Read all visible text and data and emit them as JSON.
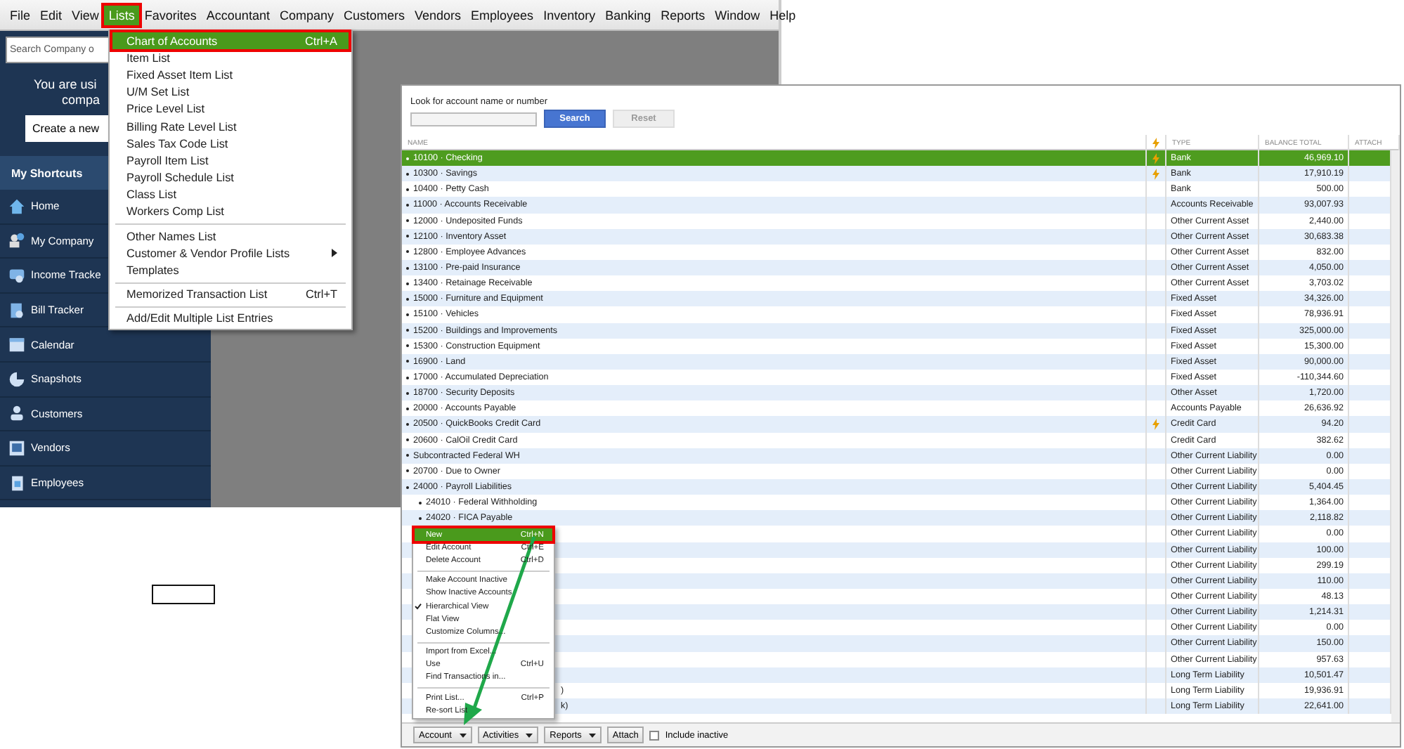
{
  "menu_bar": [
    {
      "label": "File",
      "selected": false
    },
    {
      "label": "Edit",
      "selected": false
    },
    {
      "label": "View",
      "selected": false
    },
    {
      "label": "Lists",
      "selected": true
    },
    {
      "label": "Favorites",
      "selected": false
    },
    {
      "label": "Accountant",
      "selected": false
    },
    {
      "label": "Company",
      "selected": false
    },
    {
      "label": "Customers",
      "selected": false
    },
    {
      "label": "Vendors",
      "selected": false
    },
    {
      "label": "Employees",
      "selected": false
    },
    {
      "label": "Inventory",
      "selected": false
    },
    {
      "label": "Banking",
      "selected": false
    },
    {
      "label": "Reports",
      "selected": false
    },
    {
      "label": "Window",
      "selected": false
    },
    {
      "label": "Help",
      "selected": false
    }
  ],
  "lists_menu": [
    {
      "kind": "item",
      "label": "Chart of Accounts",
      "shortcut": "Ctrl+A",
      "selected": true
    },
    {
      "kind": "item",
      "label": "Item List",
      "selected": false
    },
    {
      "kind": "item",
      "label": "Fixed Asset Item List",
      "selected": false
    },
    {
      "kind": "item",
      "label": "U/M Set List",
      "selected": false
    },
    {
      "kind": "item",
      "label": "Price Level List",
      "selected": false
    },
    {
      "kind": "item",
      "label": "Billing Rate Level List",
      "selected": false
    },
    {
      "kind": "item",
      "label": "Sales Tax Code List",
      "selected": false
    },
    {
      "kind": "item",
      "label": "Payroll Item List",
      "selected": false
    },
    {
      "kind": "item",
      "label": "Payroll Schedule List",
      "selected": false
    },
    {
      "kind": "item",
      "label": "Class List",
      "selected": false
    },
    {
      "kind": "item",
      "label": "Workers Comp List",
      "selected": false
    },
    {
      "kind": "separator"
    },
    {
      "kind": "item",
      "label": "Other Names List",
      "selected": false
    },
    {
      "kind": "submenu",
      "label": "Customer & Vendor Profile Lists",
      "selected": false
    },
    {
      "kind": "item",
      "label": "Templates",
      "selected": false
    },
    {
      "kind": "separator"
    },
    {
      "kind": "item",
      "label": "Memorized Transaction List",
      "shortcut": "Ctrl+T",
      "selected": false
    },
    {
      "kind": "separator"
    },
    {
      "kind": "item",
      "label": "Add/Edit Multiple List Entries",
      "selected": false
    }
  ],
  "sidebar": {
    "search_placeholder": "Search Company o",
    "banner": [
      "You are usi",
      "compa"
    ],
    "create_button": "Create a new",
    "shortcuts_title": "My Shortcuts",
    "items": [
      {
        "label": "Home"
      },
      {
        "label": "My Company"
      },
      {
        "label": "Income Tracke"
      },
      {
        "label": "Bill Tracker"
      },
      {
        "label": "Calendar"
      },
      {
        "label": "Snapshots"
      },
      {
        "label": "Customers"
      },
      {
        "label": "Vendors"
      },
      {
        "label": "Employees"
      }
    ]
  },
  "chart_of_accounts": {
    "search_label": "Look for account name or number",
    "search_button": "Search",
    "reset_button": "Reset",
    "columns": [
      "NAME",
      "TYPE",
      "BALANCE TOTAL",
      "ATTACH"
    ],
    "rows": [
      {
        "name": "10100 · Checking",
        "online": true,
        "type": "Bank",
        "balance": "46,969.10",
        "selected": true
      },
      {
        "name": "10300 · Savings",
        "online": true,
        "type": "Bank",
        "balance": "17,910.19",
        "selected": false
      },
      {
        "name": "10400 · Petty Cash",
        "online": false,
        "type": "Bank",
        "balance": "500.00",
        "selected": false
      },
      {
        "name": "11000 · Accounts Receivable",
        "online": false,
        "type": "Accounts Receivable",
        "balance": "93,007.93",
        "selected": false
      },
      {
        "name": "12000 · Undeposited Funds",
        "online": false,
        "type": "Other Current Asset",
        "balance": "2,440.00",
        "selected": false
      },
      {
        "name": "12100 · Inventory Asset",
        "online": false,
        "type": "Other Current Asset",
        "balance": "30,683.38",
        "selected": false
      },
      {
        "name": "12800 · Employee Advances",
        "online": false,
        "type": "Other Current Asset",
        "balance": "832.00",
        "selected": false
      },
      {
        "name": "13100 · Pre-paid Insurance",
        "online": false,
        "type": "Other Current Asset",
        "balance": "4,050.00",
        "selected": false
      },
      {
        "name": "13400 · Retainage Receivable",
        "online": false,
        "type": "Other Current Asset",
        "balance": "3,703.02",
        "selected": false
      },
      {
        "name": "15000 · Furniture and Equipment",
        "online": false,
        "type": "Fixed Asset",
        "balance": "34,326.00",
        "selected": false
      },
      {
        "name": "15100 · Vehicles",
        "online": false,
        "type": "Fixed Asset",
        "balance": "78,936.91",
        "selected": false
      },
      {
        "name": "15200 · Buildings and Improvements",
        "online": false,
        "type": "Fixed Asset",
        "balance": "325,000.00",
        "selected": false
      },
      {
        "name": "15300 · Construction Equipment",
        "online": false,
        "type": "Fixed Asset",
        "balance": "15,300.00",
        "selected": false
      },
      {
        "name": "16900 · Land",
        "online": false,
        "type": "Fixed Asset",
        "balance": "90,000.00",
        "selected": false
      },
      {
        "name": "17000 · Accumulated Depreciation",
        "online": false,
        "type": "Fixed Asset",
        "balance": "-110,344.60",
        "selected": false
      },
      {
        "name": "18700 · Security Deposits",
        "online": false,
        "type": "Other Asset",
        "balance": "1,720.00",
        "selected": false
      },
      {
        "name": "20000 · Accounts Payable",
        "online": false,
        "type": "Accounts Payable",
        "balance": "26,636.92",
        "selected": false
      },
      {
        "name": "20500 · QuickBooks Credit Card",
        "online": true,
        "type": "Credit Card",
        "balance": "94.20",
        "selected": false
      },
      {
        "name": "20600 · CalOil Credit Card",
        "online": false,
        "type": "Credit Card",
        "balance": "382.62",
        "selected": false
      },
      {
        "name": "Subcontracted Federal WH",
        "online": false,
        "type": "Other Current Liability",
        "balance": "0.00",
        "selected": false
      },
      {
        "name": "20700 · Due to Owner",
        "online": false,
        "type": "Other Current Liability",
        "balance": "0.00",
        "selected": false
      },
      {
        "name": "24000 · Payroll Liabilities",
        "online": false,
        "type": "Other Current Liability",
        "balance": "5,404.45",
        "selected": false,
        "children": [
          {
            "name": "24010 · Federal Withholding",
            "online": false,
            "type": "Other Current Liability",
            "balance": "1,364.00",
            "selected": false
          },
          {
            "name": "24020 · FICA Payable",
            "online": false,
            "type": "Other Current Liability",
            "balance": "2,118.82",
            "selected": false
          }
        ]
      },
      {
        "online": false,
        "type": "Other Current Liability",
        "balance": "0.00",
        "selected": false
      },
      {
        "online": false,
        "type": "Other Current Liability",
        "balance": "100.00",
        "selected": false
      },
      {
        "online": false,
        "type": "Other Current Liability",
        "balance": "299.19",
        "selected": false
      },
      {
        "online": false,
        "type": "Other Current Liability",
        "balance": "110.00",
        "selected": false
      },
      {
        "online": false,
        "type": "Other Current Liability",
        "balance": "48.13",
        "selected": false
      },
      {
        "online": false,
        "type": "Other Current Liability",
        "balance": "1,214.31",
        "selected": false
      },
      {
        "online": false,
        "type": "Other Current Liability",
        "balance": "0.00",
        "selected": false
      },
      {
        "online": false,
        "type": "Other Current Liability",
        "balance": "150.00",
        "selected": false
      },
      {
        "online": false,
        "type": "Other Current Liability",
        "balance": "957.63",
        "selected": false
      },
      {
        "online": false,
        "type": "Long Term Liability",
        "balance": "10,501.47",
        "selected": false
      },
      {
        "name_tail": ")",
        "online": false,
        "type": "Long Term Liability",
        "balance": "19,936.91",
        "selected": false
      },
      {
        "name_tail": "k)",
        "online": false,
        "type": "Long Term Liability",
        "balance": "22,641.00",
        "selected": false
      }
    ],
    "bottom_buttons": [
      {
        "label": "Account",
        "dropdown": true
      },
      {
        "label": "Activities",
        "dropdown": true
      },
      {
        "label": "Reports",
        "dropdown": true
      },
      {
        "label": "Attach",
        "dropdown": false
      }
    ],
    "include_inactive": {
      "label": "Include inactive",
      "checked": false
    }
  },
  "account_menu": [
    {
      "kind": "item",
      "label": "New",
      "shortcut": "Ctrl+N",
      "selected": true,
      "checked": false
    },
    {
      "kind": "item",
      "label": "Edit Account",
      "shortcut": "Ctrl+E",
      "selected": false,
      "checked": false
    },
    {
      "kind": "item",
      "label": "Delete Account",
      "shortcut": "Ctrl+D",
      "selected": false,
      "checked": false
    },
    {
      "kind": "separator"
    },
    {
      "kind": "item",
      "label": "Make Account Inactive",
      "selected": false,
      "checked": false
    },
    {
      "kind": "item",
      "label": "Show Inactive Accounts",
      "selected": false,
      "checked": false
    },
    {
      "kind": "item",
      "label": "Hierarchical View",
      "selected": false,
      "checked": true
    },
    {
      "kind": "item",
      "label": "Flat View",
      "selected": false,
      "checked": false
    },
    {
      "kind": "item",
      "label": "Customize Columns...",
      "selected": false,
      "checked": false
    },
    {
      "kind": "separator"
    },
    {
      "kind": "item",
      "label": "Import from Excel...",
      "selected": false,
      "checked": false
    },
    {
      "kind": "item",
      "label": "Use",
      "shortcut": "Ctrl+U",
      "selected": false,
      "checked": false
    },
    {
      "kind": "item",
      "label": "Find Transactions in...",
      "selected": false,
      "checked": false
    },
    {
      "kind": "separator"
    },
    {
      "kind": "item",
      "label": "Print List...",
      "shortcut": "Ctrl+P",
      "selected": false,
      "checked": false
    },
    {
      "kind": "item",
      "label": "Re-sort List",
      "selected": false,
      "checked": false
    }
  ]
}
